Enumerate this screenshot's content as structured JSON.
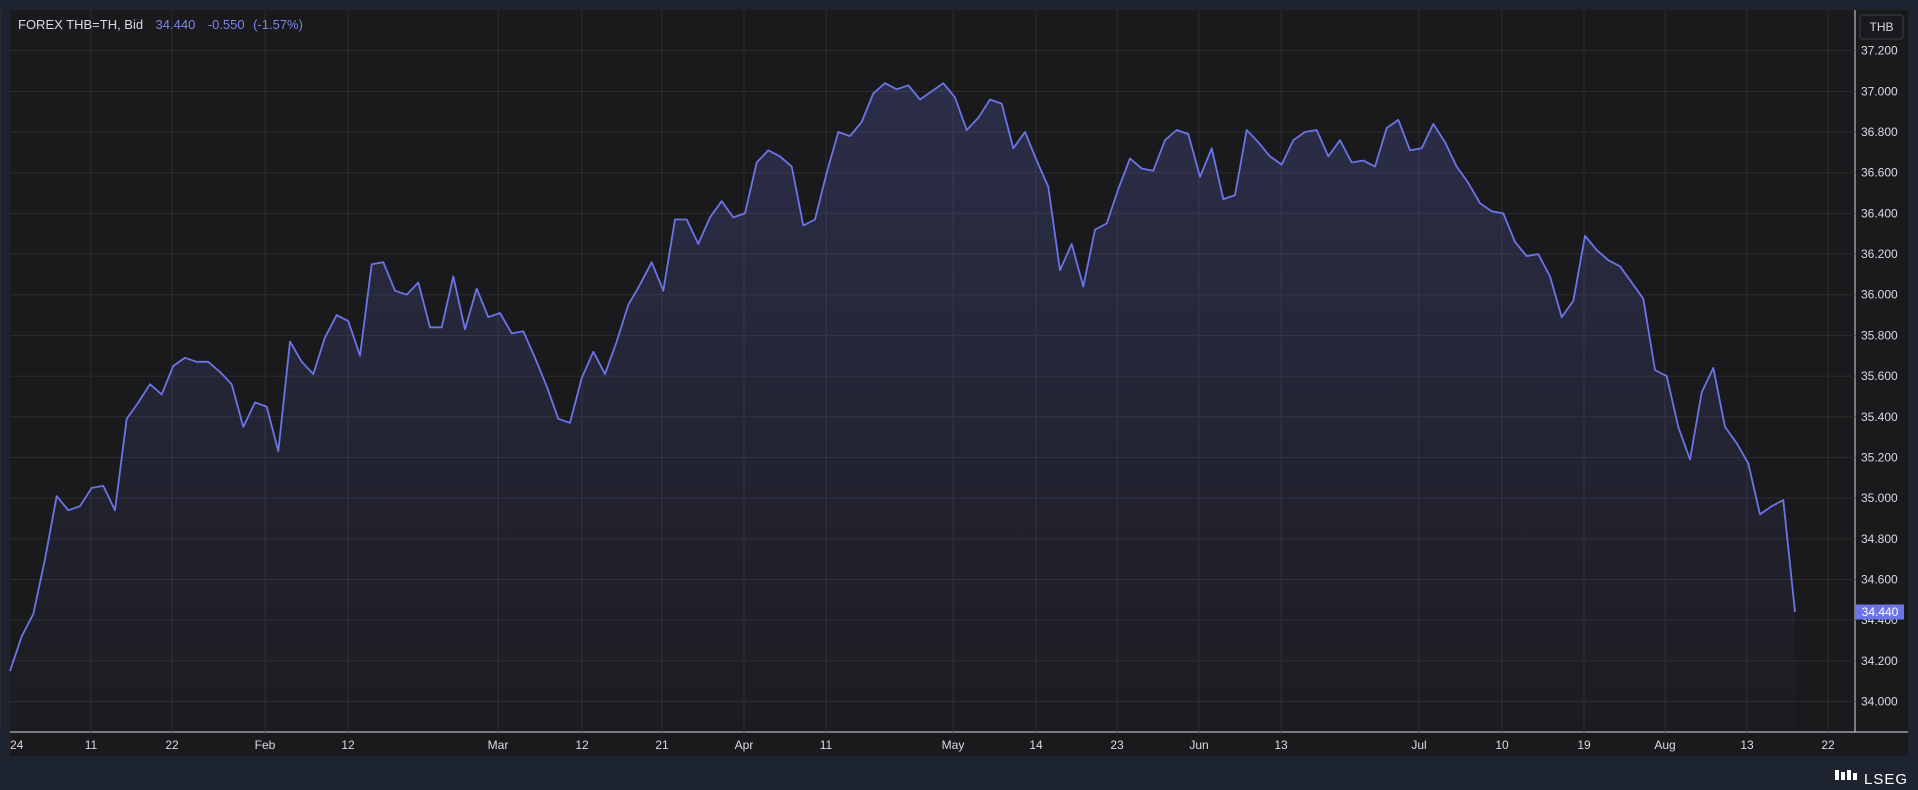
{
  "header": {
    "instrument": "FOREX THB=TH, Bid",
    "last": "34.440",
    "change": "-0.550",
    "change_pct": "(-1.57%)"
  },
  "currency_button": "THB",
  "brand": "LSEG",
  "colors": {
    "line": "#6b74e8",
    "plot_bg": "#1a1a1c",
    "frame_bg": "#1e2330",
    "grid": "#2c2c30"
  },
  "chart_data": {
    "type": "area",
    "series": [
      {
        "values": [
          34.15,
          34.32,
          34.43,
          34.7,
          35.01,
          34.94,
          34.96,
          35.05,
          35.06,
          34.94,
          35.39,
          35.47,
          35.56,
          35.51,
          35.65,
          35.69,
          35.67,
          35.67,
          35.62,
          35.56,
          35.35,
          35.47,
          35.45,
          35.23,
          35.77,
          35.67,
          35.61,
          35.79,
          35.9,
          35.87,
          35.7,
          36.15,
          36.16,
          36.02,
          36.0,
          36.06,
          35.84,
          35.84,
          36.09,
          35.83,
          36.03,
          35.89,
          35.91,
          35.81,
          35.82,
          35.69,
          35.55,
          35.39,
          35.37,
          35.59,
          35.72,
          35.61,
          35.77,
          35.95,
          36.05,
          36.16,
          36.02,
          36.37,
          36.37,
          36.25,
          36.38,
          36.46,
          36.38,
          36.4,
          36.65,
          36.71,
          36.68,
          36.63,
          36.34,
          36.37,
          36.6,
          36.8,
          36.78,
          36.85,
          36.99,
          37.04,
          37.01,
          37.03,
          36.96,
          37.0,
          37.04,
          36.97,
          36.81,
          36.87,
          36.96,
          36.94,
          36.72,
          36.8,
          36.66,
          36.53,
          36.12,
          36.25,
          36.04,
          36.32,
          36.35,
          36.52,
          36.67,
          36.62,
          36.61,
          36.76,
          36.81,
          36.79,
          36.58,
          36.72,
          36.47,
          36.49,
          36.81,
          36.75,
          36.68,
          36.64,
          36.76,
          36.8,
          36.81,
          36.68,
          36.76,
          36.65,
          36.66,
          36.63,
          36.82,
          36.86,
          36.71,
          36.72,
          36.84,
          36.75,
          36.63,
          36.55,
          36.45,
          36.41,
          36.4,
          36.26,
          36.19,
          36.2,
          36.09,
          35.89,
          35.97,
          36.29,
          36.22,
          36.17,
          36.14,
          36.06,
          35.98,
          35.63,
          35.6,
          35.35,
          35.19,
          35.52,
          35.64,
          35.35,
          35.27,
          35.17,
          34.92,
          34.96,
          34.99,
          34.44
        ]
      }
    ],
    "x_tick_labels": [
      "24",
      "11",
      "22",
      "Feb",
      "12",
      "Mar",
      "12",
      "21",
      "Apr",
      "11",
      "May",
      "14",
      "23",
      "Jun",
      "13",
      "Jul",
      "10",
      "19",
      "Aug",
      "13",
      "22"
    ],
    "y_tick_labels": [
      "34.000",
      "34.200",
      "34.400",
      "34.600",
      "34.800",
      "35.000",
      "35.200",
      "35.400",
      "35.600",
      "35.800",
      "36.000",
      "36.200",
      "36.400",
      "36.600",
      "36.800",
      "37.000",
      "37.200"
    ],
    "ylim": [
      33.85,
      37.4
    ],
    "grid": true,
    "last_value_label": "34.440"
  }
}
